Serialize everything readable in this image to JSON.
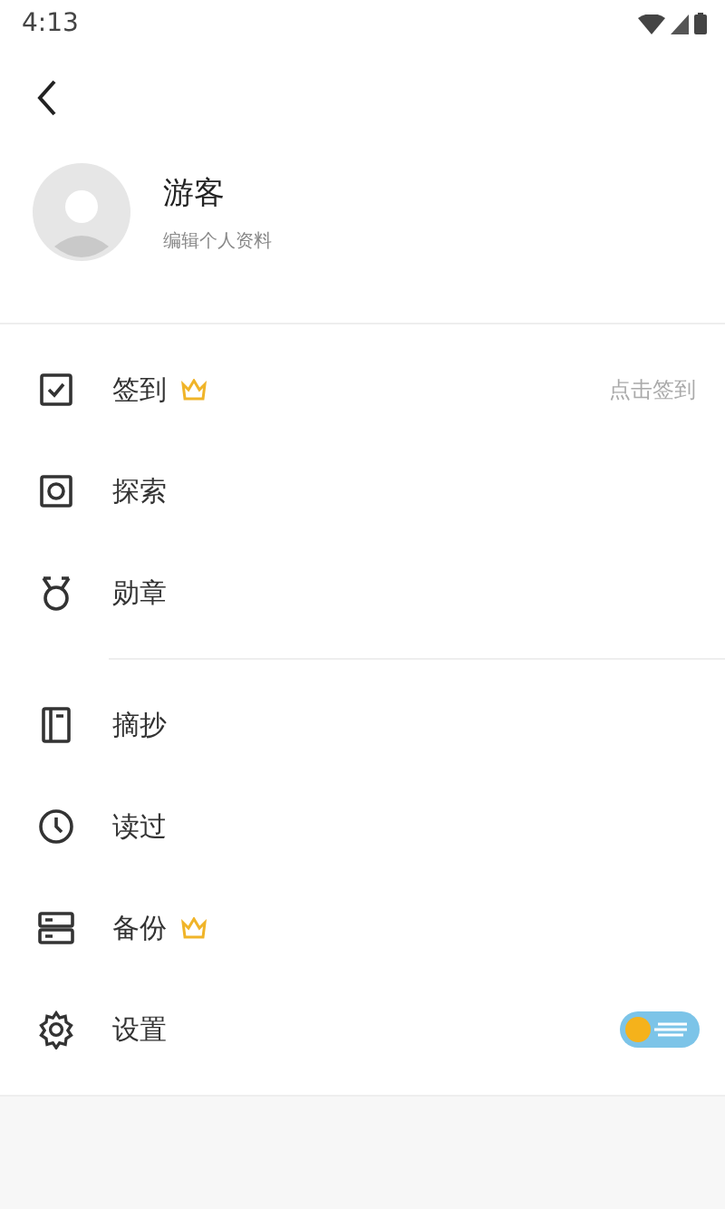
{
  "status_bar": {
    "time": "4:13"
  },
  "profile": {
    "name": "游客",
    "subtitle": "编辑个人资料"
  },
  "sections": [
    {
      "items": [
        {
          "label": "签到",
          "premium": true,
          "hint": "点击签到"
        },
        {
          "label": "探索",
          "premium": false
        },
        {
          "label": "勋章",
          "premium": false
        }
      ]
    },
    {
      "items": [
        {
          "label": "摘抄",
          "premium": false
        },
        {
          "label": "读过",
          "premium": false
        },
        {
          "label": "备份",
          "premium": true
        },
        {
          "label": "设置",
          "premium": false,
          "toggle": {
            "on": false
          }
        }
      ]
    }
  ]
}
